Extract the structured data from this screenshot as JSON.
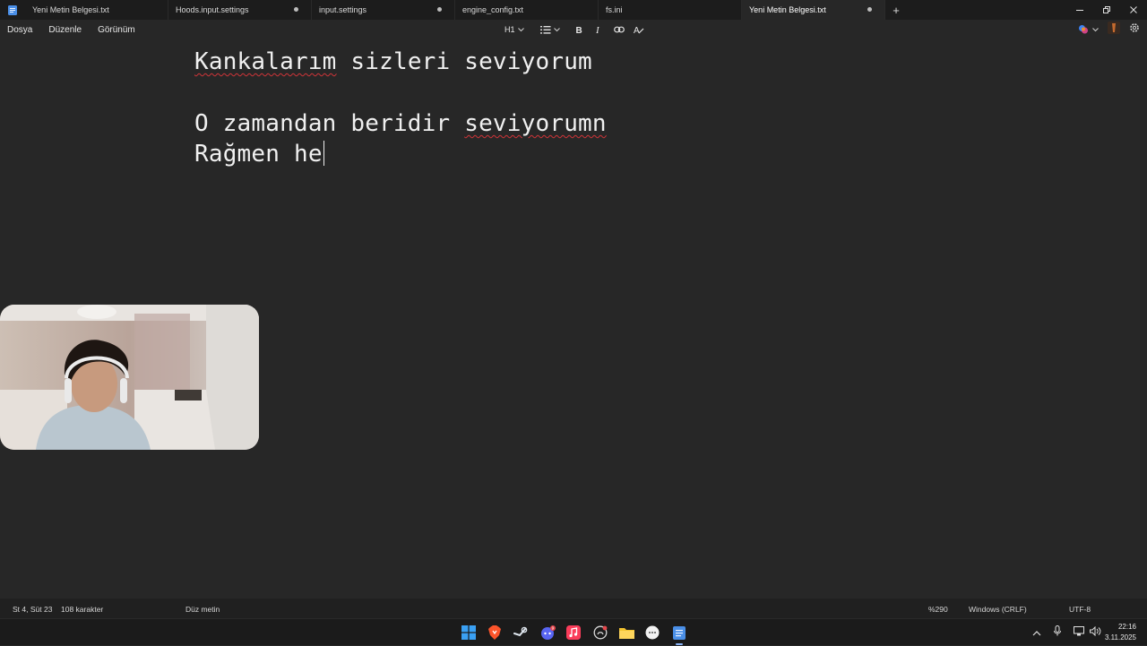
{
  "tabs": [
    {
      "label": "Yeni Metin Belgesi.txt",
      "modified": false,
      "active": false
    },
    {
      "label": "Hoods.input.settings",
      "modified": true,
      "active": false
    },
    {
      "label": "input.settings",
      "modified": true,
      "active": false
    },
    {
      "label": "engine_config.txt",
      "modified": false,
      "active": false
    },
    {
      "label": "fs.ini",
      "modified": false,
      "active": false
    },
    {
      "label": "Yeni Metin Belgesi.txt",
      "modified": true,
      "active": true
    }
  ],
  "new_tab_label": "+",
  "menu": {
    "file": "Dosya",
    "edit": "Düzenle",
    "view": "Görünüm"
  },
  "toolbar": {
    "heading": "H1"
  },
  "document": {
    "line1_word1": "Kankalarım",
    "line1_rest": " sizleri seviyorum",
    "line3_start": "O zamandan beridir ",
    "line3_word": "seviyorumn",
    "line4": "Rağmen he"
  },
  "status": {
    "position": "St 4, Süt 23",
    "chars": "108 karakter",
    "format": "Düz metin",
    "zoom": "%290",
    "line_endings": "Windows (CRLF)",
    "encoding": "UTF-8"
  },
  "clock": {
    "time": "22:16",
    "date": "3.11.2025"
  },
  "taskbar_badges": {
    "discord": "9"
  },
  "colors": {
    "accent": "#8ab4f8",
    "spellcheck": "#d13438",
    "editor_bg": "#272727"
  }
}
